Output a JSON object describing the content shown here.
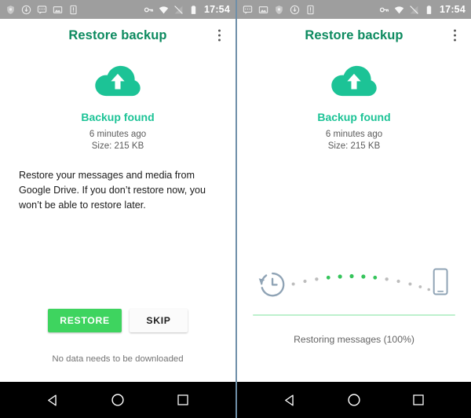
{
  "status_bar": {
    "time": "17:54",
    "left_icons_left_screen": [
      "shield-icon",
      "download-circle-icon",
      "chat-icon",
      "image-icon",
      "sim-card-icon"
    ],
    "left_icons_right_screen": [
      "chat-icon",
      "image-icon",
      "shield-icon",
      "download-circle-icon",
      "sim-card-icon"
    ],
    "right_icons": [
      "vpn-key-icon",
      "wifi-icon",
      "signal-off-icon",
      "battery-icon"
    ],
    "background_color": "#9e9e9e"
  },
  "app_bar": {
    "title": "Restore backup",
    "title_color": "#0c8a5f",
    "overflow_menu": "more-options"
  },
  "backup": {
    "icon": "cloud-upload-icon",
    "icon_color": "#1cc396",
    "status": "Backup found",
    "time_ago": "6 minutes ago",
    "size": "Size: 215 KB"
  },
  "left_screen": {
    "description": "Restore your messages and media from Google Drive. If you don’t restore now, you won’t be able to restore later.",
    "restore_label": "RESTORE",
    "skip_label": "SKIP",
    "restore_color": "#3ed45f",
    "footnote": "No data needs to be downloaded"
  },
  "right_screen": {
    "progress_label": "Restoring messages (100%)",
    "progress_percent": 100,
    "progress_fill_color": "#bdf0cd",
    "source_icon": "history-restore-icon",
    "target_icon": "phone-icon",
    "dots_total": 13,
    "dots_active": 5,
    "dot_active_color": "#35c45b",
    "dot_inactive_color": "#bdbdbd"
  },
  "nav_bar": {
    "back": "back-button",
    "home": "home-button",
    "recents": "recents-button",
    "background_color": "#000000"
  }
}
